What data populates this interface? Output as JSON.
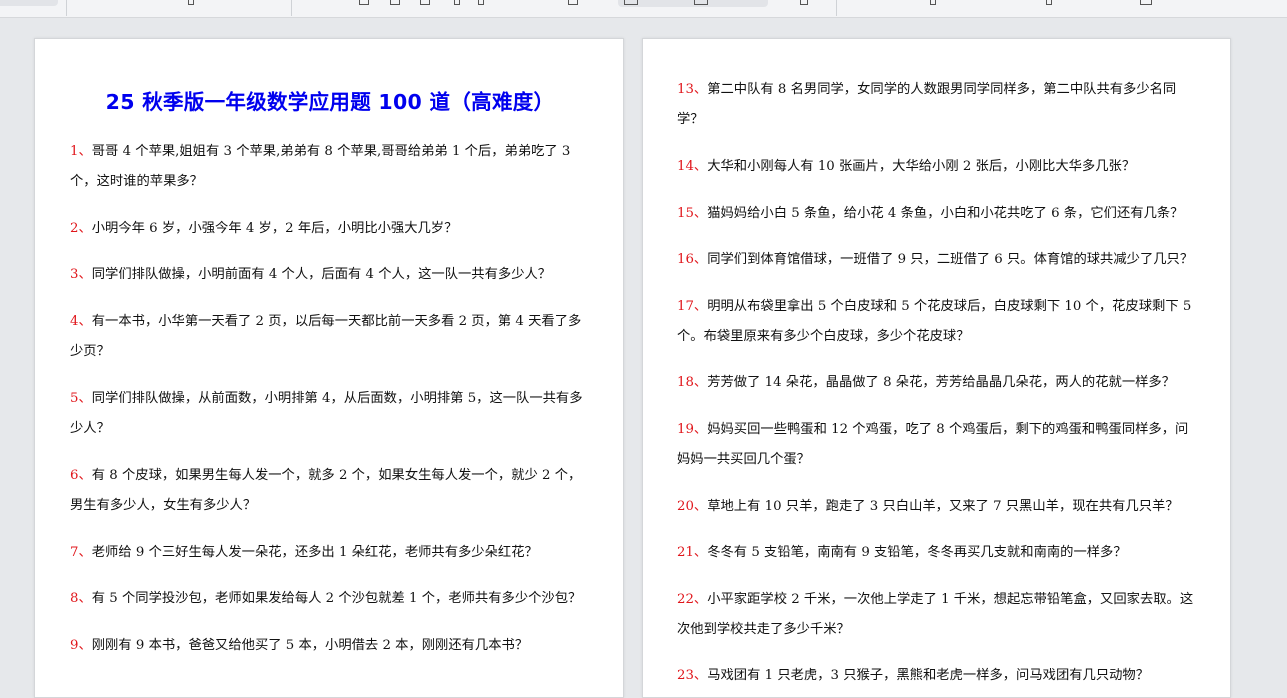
{
  "title": "25 秋季版一年级数学应用题 100 道（高难度）",
  "colors": {
    "title": "#0000ee",
    "number": "#e0161b",
    "text": "#111111",
    "page": "#ffffff",
    "workspace": "#e6e8eb"
  },
  "questions_left": [
    {
      "num": "1、",
      "text": "哥哥 4 个苹果,姐姐有 3 个苹果,弟弟有 8 个苹果,哥哥给弟弟 1 个后，弟弟吃了 3 个，这时谁的苹果多？"
    },
    {
      "num": "2、",
      "text": "小明今年 6 岁，小强今年 4 岁，2 年后，小明比小强大几岁？"
    },
    {
      "num": "3、",
      "text": "同学们排队做操，小明前面有 4 个人，后面有 4 个人，这一队一共有多少人？"
    },
    {
      "num": "4、",
      "text": "有一本书，小华第一天看了 2 页，以后每一天都比前一天多看 2 页，第 4 天看了多少页？"
    },
    {
      "num": "5、",
      "text": "同学们排队做操，从前面数，小明排第 4，从后面数，小明排第 5，这一队一共有多少人？"
    },
    {
      "num": "6、",
      "text": "有 8 个皮球，如果男生每人发一个，就多 2 个，如果女生每人发一个，就少 2 个，男生有多少人，女生有多少人？"
    },
    {
      "num": "7、",
      "text": "老师给 9 个三好生每人发一朵花，还多出 1 朵红花，老师共有多少朵红花？"
    },
    {
      "num": "8、",
      "text": "有 5 个同学投沙包，老师如果发给每人 2 个沙包就差 1 个，老师共有多少个沙包？"
    },
    {
      "num": "9、",
      "text": "刚刚有 9 本书，爸爸又给他买了 5 本，小明借去 2 本，刚刚还有几本书？"
    }
  ],
  "questions_right": [
    {
      "num": "13、",
      "text": "第二中队有 8 名男同学，女同学的人数跟男同学同样多，第二中队共有多少名同学？"
    },
    {
      "num": "14、",
      "text": "大华和小刚每人有 10 张画片，大华给小刚 2 张后，小刚比大华多几张？"
    },
    {
      "num": "15、",
      "text": "猫妈妈给小白 5 条鱼，给小花 4 条鱼，小白和小花共吃了 6 条，它们还有几条？"
    },
    {
      "num": "16、",
      "text": "同学们到体育馆借球，一班借了 9 只，二班借了 6 只。体育馆的球共减少了几只？"
    },
    {
      "num": "17、",
      "text": "明明从布袋里拿出 5 个白皮球和 5 个花皮球后，白皮球剩下 10 个，花皮球剩下 5 个。布袋里原来有多少个白皮球，多少个花皮球？"
    },
    {
      "num": "18、",
      "text": "芳芳做了 14 朵花，晶晶做了 8 朵花，芳芳给晶晶几朵花，两人的花就一样多？"
    },
    {
      "num": "19、",
      "text": "妈妈买回一些鸭蛋和 12 个鸡蛋，吃了 8 个鸡蛋后，剩下的鸡蛋和鸭蛋同样多，问妈妈一共买回几个蛋？"
    },
    {
      "num": "20、",
      "text": "草地上有 10 只羊，跑走了 3 只白山羊，又来了 7 只黑山羊，现在共有几只羊？"
    },
    {
      "num": "21、",
      "text": "冬冬有 5 支铅笔，南南有 9 支铅笔，冬冬再买几支就和南南的一样多？"
    },
    {
      "num": "22、",
      "text": "小平家距学校 2 千米，一次他上学走了 1 千米，想起忘带铅笔盒，又回家去取。这次他到学校共走了多少千米？"
    },
    {
      "num": "23、",
      "text": "马戏团有 1 只老虎，3 只猴子，黑熊和老虎一样多，问马戏团有几只动物？"
    }
  ]
}
